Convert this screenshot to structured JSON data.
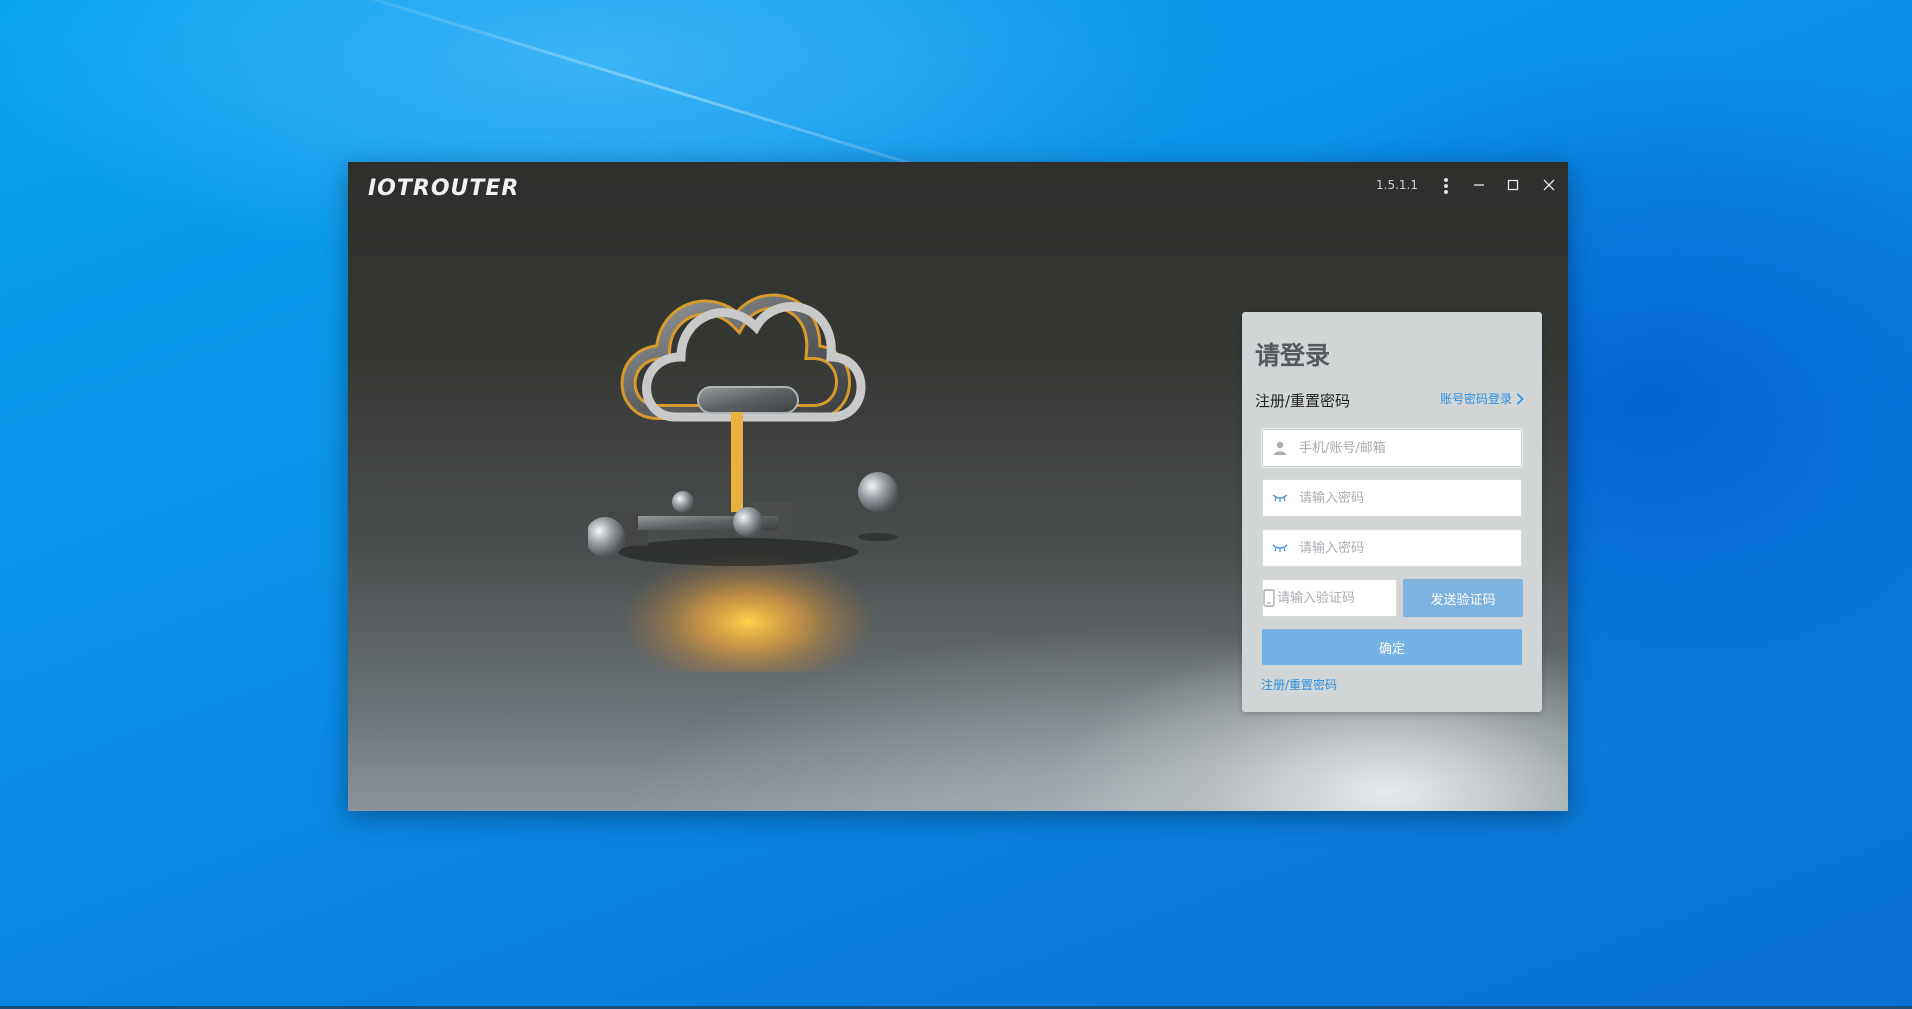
{
  "app": {
    "logo": "IOTROUTER",
    "version": "1.5.1.1"
  },
  "window_controls": {
    "menu_icon": "vertical-dots-icon",
    "minimize_icon": "minimize-icon",
    "maximize_icon": "maximize-icon",
    "close_icon": "close-icon"
  },
  "login": {
    "title": "请登录",
    "subtitle": "注册/重置密码",
    "switch_link": "账号密码登录",
    "account_placeholder": "手机/账号/邮箱",
    "password_placeholder": "请输入密码",
    "confirm_password_placeholder": "请输入密码",
    "code_placeholder": "请输入验证码",
    "send_code_button": "发送验证码",
    "confirm_button": "确定",
    "bottom_link": "注册/重置密码"
  },
  "colors": {
    "accent": "#2b90e0",
    "button": "#75b1e2",
    "panel": "#d2d5d6"
  }
}
